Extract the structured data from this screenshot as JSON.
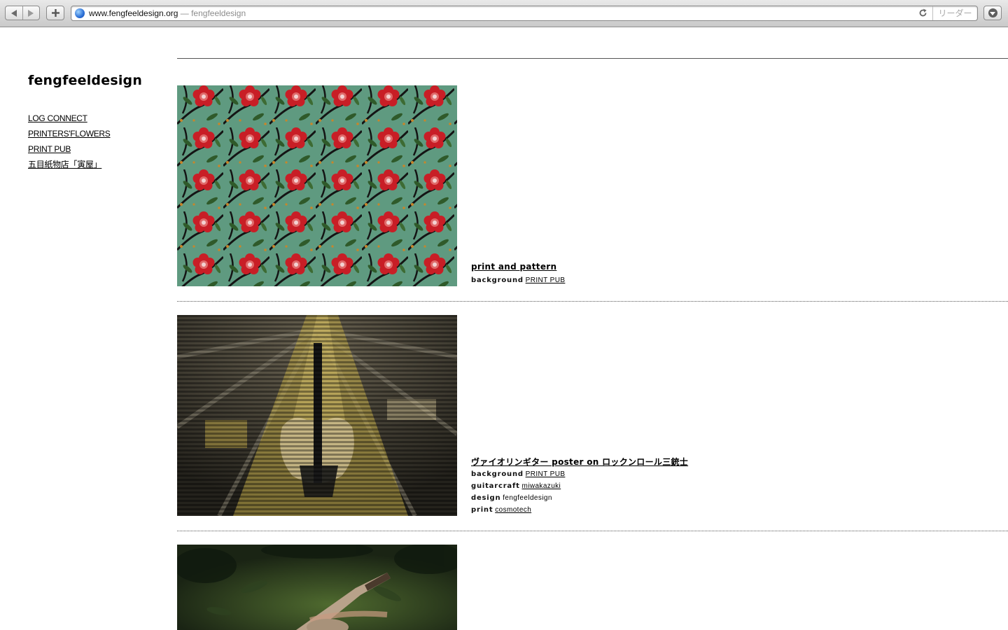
{
  "browser": {
    "url_domain": "www.fengfeeldesign.org",
    "url_sep": " — ",
    "page_title": "fengfeeldesign",
    "reader_label": "リーダー"
  },
  "site": {
    "title": "fengfeeldesign",
    "nav": [
      "LOG CONNECT",
      "PRINTERS'FLOWERS",
      "PRINT PUB",
      "五目紙物店「寅屋」"
    ]
  },
  "entries": [
    {
      "title": "print and pattern",
      "credits": [
        {
          "key": "background",
          "value": "PRINT PUB"
        }
      ]
    },
    {
      "title": "ヴァイオリンギター poster on ロックンロール三銃士",
      "credits": [
        {
          "key": "background",
          "value": "PRINT PUB"
        },
        {
          "key": "guitarcraft",
          "value": "miwakazuki"
        },
        {
          "key": "design",
          "value": "fengfeeldesign"
        },
        {
          "key": "print",
          "value": "cosmotech"
        }
      ]
    }
  ],
  "colors": {
    "pattern_green": "#5f9a80",
    "flower_red": "#d0222b",
    "poster_gold": "#c9b04a",
    "moss_green": "#3f5a2a"
  }
}
